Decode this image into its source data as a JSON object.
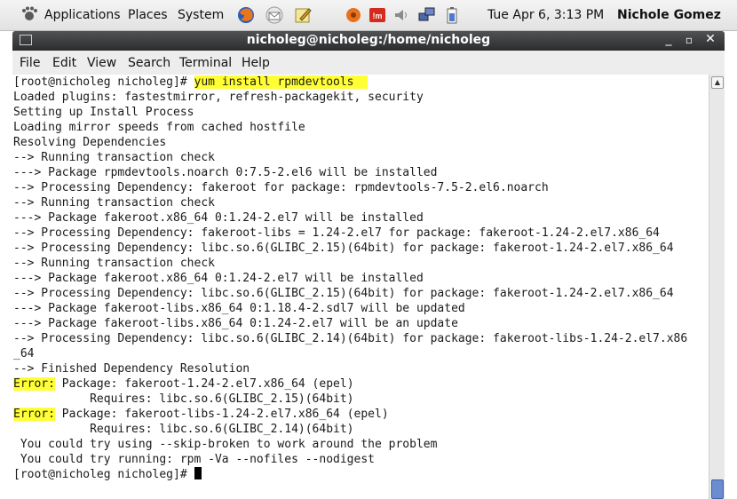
{
  "panel": {
    "menus": [
      "Applications",
      "Places",
      "System"
    ],
    "clock": "Tue Apr  6,  3:13 PM",
    "user": "Nichole Gomez",
    "icons": [
      "gnome-foot-icon",
      "firefox-icon",
      "mail-icon",
      "edit-icon",
      "settings-icon",
      "im-icon",
      "volume-icon",
      "network-icon",
      "battery-icon"
    ]
  },
  "window": {
    "title": "nicholeg@nicholeg:/home/nicholeg",
    "buttons": [
      "_",
      "▫",
      "✕"
    ],
    "menus": [
      "File",
      "Edit",
      "View",
      "Search",
      "Terminal",
      "Help"
    ]
  },
  "terminal": {
    "prompt": "[root@nicholeg nicholeg]# ",
    "command": "yum install rpmdevtools",
    "error_label": "Error:",
    "lines": [
      "Loaded plugins: fastestmirror, refresh-packagekit, security",
      "Setting up Install Process",
      "Loading mirror speeds from cached hostfile",
      "Resolving Dependencies",
      "--> Running transaction check",
      "---> Package rpmdevtools.noarch 0:7.5-2.el6 will be installed",
      "--> Processing Dependency: fakeroot for package: rpmdevtools-7.5-2.el6.noarch",
      "--> Running transaction check",
      "---> Package fakeroot.x86_64 0:1.24-2.el7 will be installed",
      "--> Processing Dependency: fakeroot-libs = 1.24-2.el7 for package: fakeroot-1.24-2.el7.x86_64",
      "--> Processing Dependency: libc.so.6(GLIBC_2.15)(64bit) for package: fakeroot-1.24-2.el7.x86_64",
      "--> Running transaction check",
      "---> Package fakeroot.x86_64 0:1.24-2.el7 will be installed",
      "--> Processing Dependency: libc.so.6(GLIBC_2.15)(64bit) for package: fakeroot-1.24-2.el7.x86_64",
      "---> Package fakeroot-libs.x86_64 0:1.18.4-2.sdl7 will be updated",
      "---> Package fakeroot-libs.x86_64 0:1.24-2.el7 will be an update",
      "--> Processing Dependency: libc.so.6(GLIBC_2.14)(64bit) for package: fakeroot-libs-1.24-2.el7.x86",
      "_64",
      "--> Finished Dependency Resolution"
    ],
    "error1_rest": " Package: fakeroot-1.24-2.el7.x86_64 (epel)",
    "error1_req": "           Requires: libc.so.6(GLIBC_2.15)(64bit)",
    "error2_rest": " Package: fakeroot-libs-1.24-2.el7.x86_64 (epel)",
    "error2_req": "           Requires: libc.so.6(GLIBC_2.14)(64bit)",
    "tip1": " You could try using --skip-broken to work around the problem",
    "tip2": " You could try running: rpm -Va --nofiles --nodigest",
    "highlight_color": "#ffff33"
  }
}
